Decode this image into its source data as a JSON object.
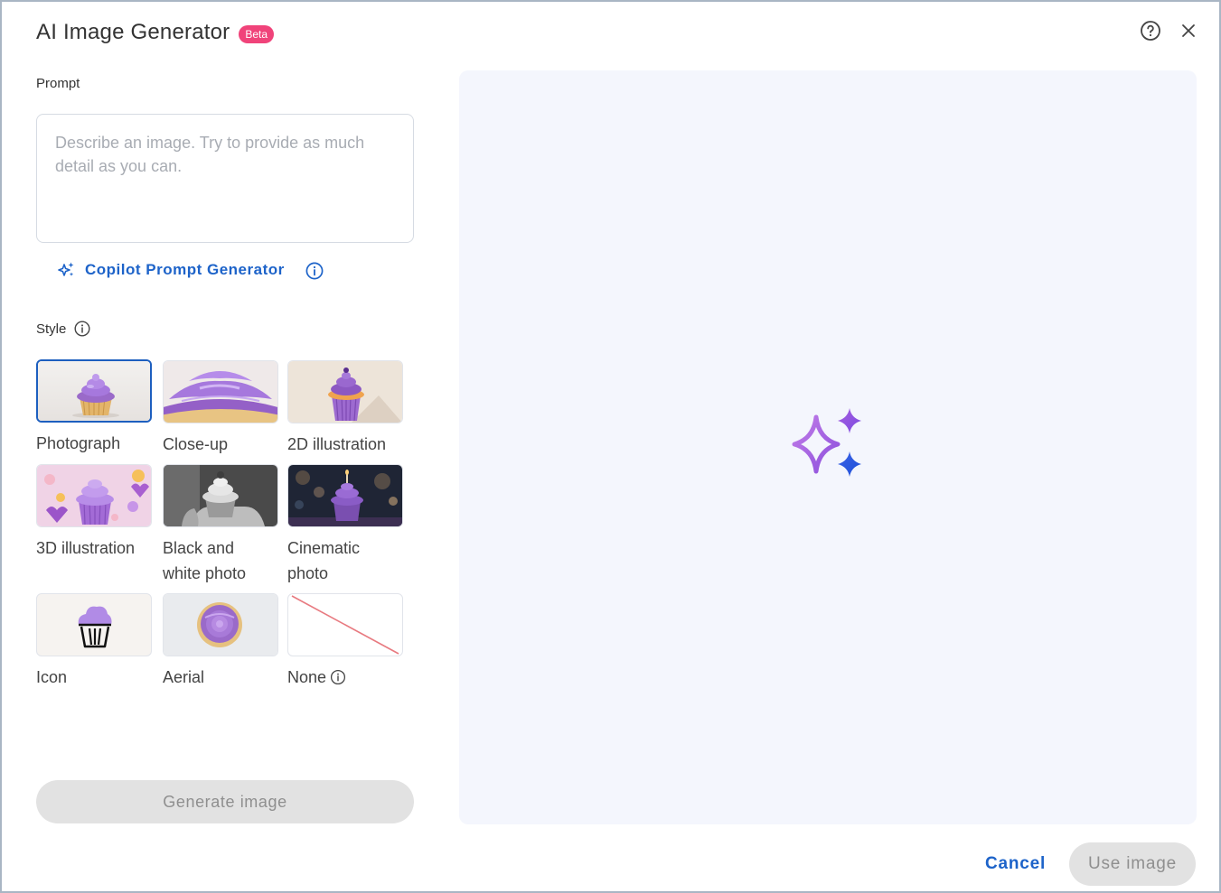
{
  "dialog": {
    "title": "AI Image Generator",
    "badge": "Beta"
  },
  "prompt": {
    "label": "Prompt",
    "placeholder": "Describe an image. Try to provide as much detail as you can.",
    "value": ""
  },
  "copilot": {
    "label": "Copilot Prompt Generator"
  },
  "style": {
    "label": "Style",
    "selected": "Photograph",
    "options": [
      {
        "label": "Photograph"
      },
      {
        "label": "Close-up"
      },
      {
        "label": "2D illustration"
      },
      {
        "label": "3D illustration"
      },
      {
        "label": "Black and white photo"
      },
      {
        "label": "Cinematic photo"
      },
      {
        "label": "Icon"
      },
      {
        "label": "Aerial"
      },
      {
        "label": "None"
      }
    ]
  },
  "actions": {
    "generate": "Generate image",
    "cancel": "Cancel",
    "use_image": "Use image"
  },
  "colors": {
    "accent": "#1d63c9",
    "badge": "#f0437a",
    "disabled_bg": "#e2e2e2",
    "disabled_text": "#8f8f8f",
    "preview_bg": "#f4f6fd",
    "frosting": "#a678dd"
  }
}
